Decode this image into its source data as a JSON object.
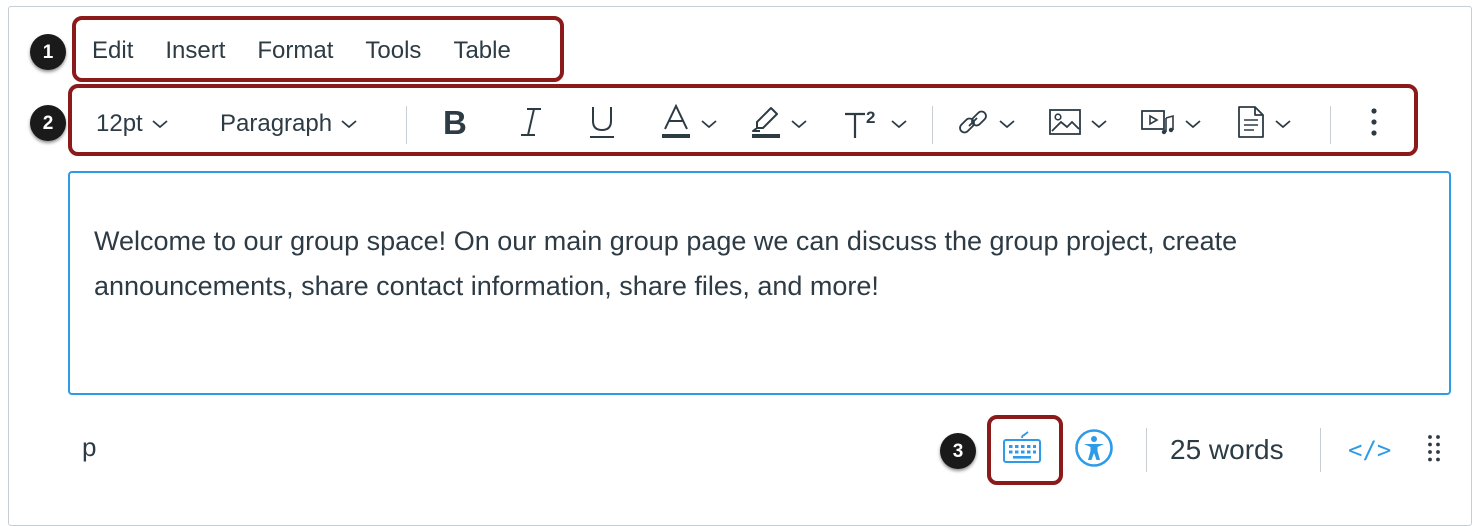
{
  "callouts": [
    "1",
    "2",
    "3"
  ],
  "menubar": {
    "items": [
      "Edit",
      "Insert",
      "Format",
      "Tools",
      "Table"
    ]
  },
  "toolbar": {
    "font_size": "12pt",
    "block_format": "Paragraph"
  },
  "editor": {
    "content": "Welcome to our group space! On our main group page we can discuss the group project, create announcements, share contact information, share files, and more!"
  },
  "statusbar": {
    "path": "p",
    "word_count": "25 words",
    "html_toggle": "</>"
  },
  "colors": {
    "accent": "#2d9be8",
    "highlight": "#8b1a1a",
    "text": "#2d3b45",
    "border": "#c7cdd1"
  },
  "icons": [
    "bold-icon",
    "italic-icon",
    "underline-icon",
    "text-color-icon",
    "highlight-color-icon",
    "superscript-icon",
    "link-icon",
    "image-icon",
    "media-icon",
    "document-icon",
    "more-vertical-icon",
    "keyboard-icon",
    "accessibility-icon",
    "resize-handle-icon"
  ]
}
